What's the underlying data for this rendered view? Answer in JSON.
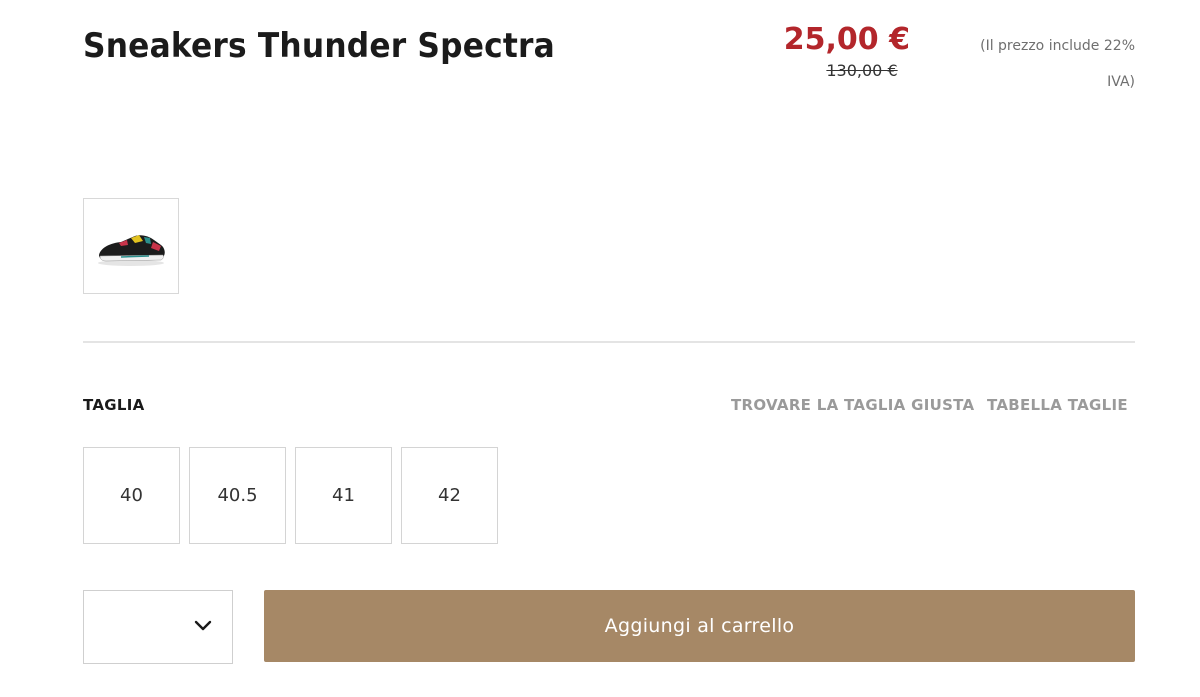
{
  "product": {
    "title": "Sneakers Thunder Spectra",
    "price_current": "25,00 €",
    "price_old": "130,00 €",
    "vat_note": "(Il prezzo include 22% IVA)"
  },
  "gallery": {
    "thumbnails": [
      {
        "icon": "sneaker-thumbnail"
      }
    ]
  },
  "sizes": {
    "label": "TAGLIA",
    "find_size_link": "TROVARE LA TAGLIA GIUSTA",
    "size_chart_link": "TABELLA TAGLIE",
    "options": [
      "40",
      "40.5",
      "41",
      "42"
    ]
  },
  "purchase": {
    "quantity_icon": "chevron-down-icon",
    "add_to_cart_label": "Aggiungi al carrello"
  },
  "colors": {
    "price_red": "#b3262b",
    "button_brown": "#a68866"
  }
}
